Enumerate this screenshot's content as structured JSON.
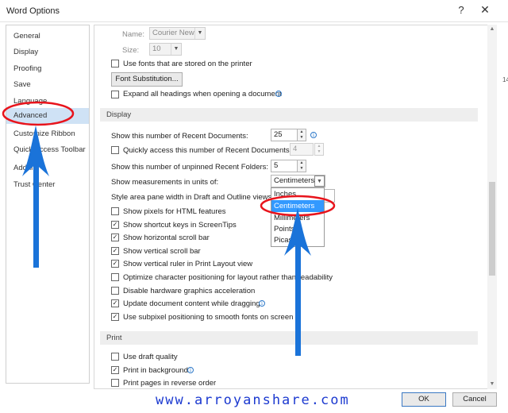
{
  "window": {
    "title": "Word Options",
    "help_label": "?",
    "close_label": "✕"
  },
  "sidebar": {
    "items": [
      {
        "label": "General"
      },
      {
        "label": "Display"
      },
      {
        "label": "Proofing"
      },
      {
        "label": "Save"
      },
      {
        "label": "Language"
      },
      {
        "label": "Advanced",
        "selected": true
      },
      {
        "label": "Customize Ribbon"
      },
      {
        "label": "Quick Access Toolbar"
      },
      {
        "label": "Add-ins"
      },
      {
        "label": "Trust Center"
      }
    ]
  },
  "font_substitution": {
    "name_label": "Name:",
    "name_value": "Courier New",
    "size_label": "Size:",
    "size_value": "10",
    "use_printer_fonts": "Use fonts that are stored on the printer",
    "button_label": "Font Substitution...",
    "expand_headings": "Expand all headings when opening a document"
  },
  "display": {
    "header": "Display",
    "recent_docs_label": "Show this number of Recent Documents:",
    "recent_docs_value": "25",
    "quick_access_label": "Quickly access this number of Recent Documents:",
    "quick_access_value": "4",
    "unpinned_label": "Show this number of unpinned Recent Folders:",
    "unpinned_value": "5",
    "units_label": "Show measurements in units of:",
    "units_value": "Centimeters",
    "style_area_label": "Style area pane width in Draft and Outline views:",
    "units_options": [
      "Inches",
      "Centimeters",
      "Millimeters",
      "Points",
      "Picas"
    ],
    "units_selected_index": 1,
    "options": [
      {
        "label": "Show pixels for HTML features",
        "checked": false
      },
      {
        "label": "Show shortcut keys in ScreenTips",
        "checked": true
      },
      {
        "label": "Show horizontal scroll bar",
        "checked": true
      },
      {
        "label": "Show vertical scroll bar",
        "checked": true
      },
      {
        "label": "Show vertical ruler in Print Layout view",
        "checked": true
      },
      {
        "label": "Optimize character positioning for layout rather than readability",
        "checked": false
      },
      {
        "label": "Disable hardware graphics acceleration",
        "checked": false
      },
      {
        "label": "Update document content while dragging",
        "checked": true
      },
      {
        "label": "Use subpixel positioning to smooth fonts on screen",
        "checked": true
      }
    ]
  },
  "print": {
    "header": "Print",
    "options": [
      {
        "label": "Use draft quality",
        "checked": false
      },
      {
        "label": "Print in background",
        "checked": true
      },
      {
        "label": "Print pages in reverse order",
        "checked": false
      }
    ]
  },
  "footer": {
    "ok_label": "OK",
    "cancel_label": "Cancel",
    "watermark": "www.arroyanshare.com"
  },
  "colors": {
    "selected_sidebar": "#cfe2f5",
    "dropdown_highlight": "#3399ff",
    "annotation_red": "#e8141c",
    "annotation_blue": "#1a73d9",
    "watermark": "#1c3ad0"
  },
  "icons": {
    "check": "checkmark-icon",
    "info": "info-icon",
    "dropdown": "chevron-down-icon"
  },
  "background_fragment": "14"
}
